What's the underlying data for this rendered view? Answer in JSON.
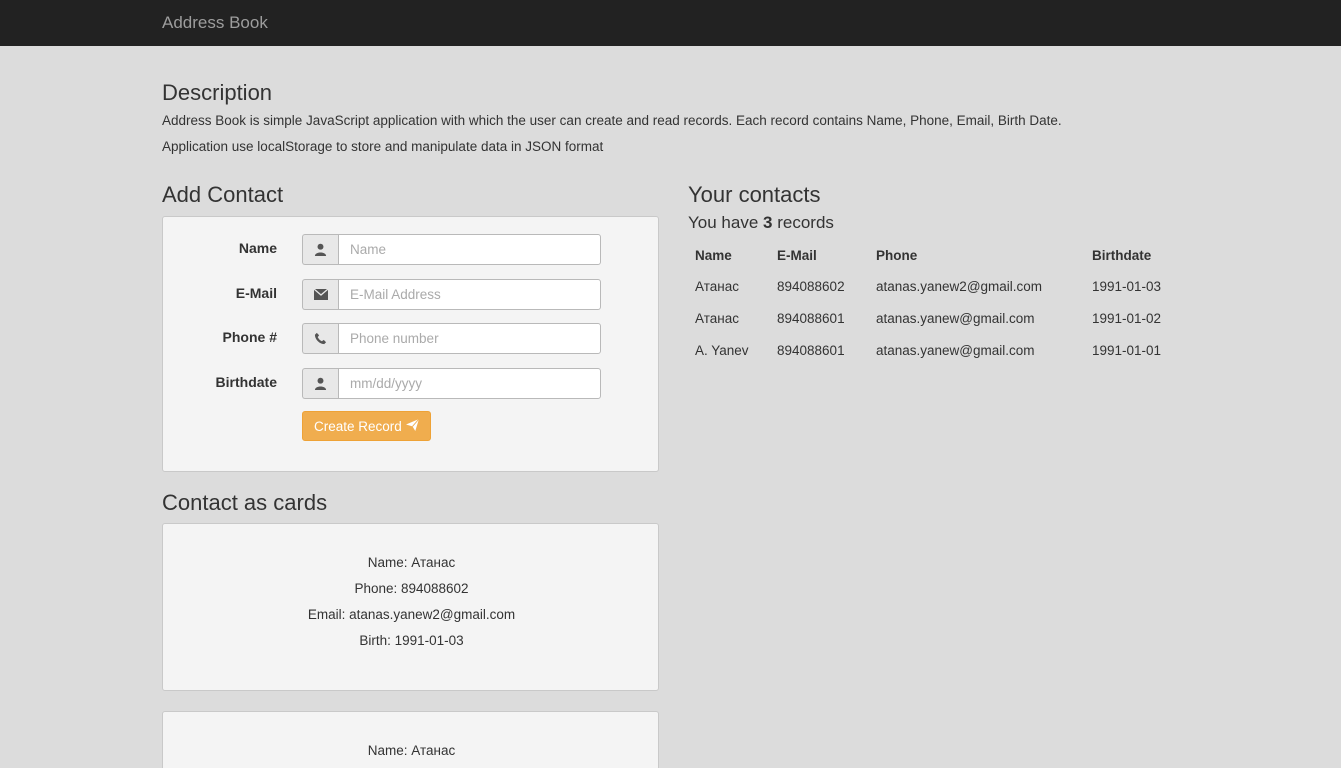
{
  "navbar": {
    "brand": "Address Book"
  },
  "description": {
    "title": "Description",
    "line1": "Address Book is simple JavaScript application with which the user can create and read records. Each record contains Name, Phone, Email, Birth Date.",
    "line2": "Application use localStorage to store and manipulate data in JSON format"
  },
  "add_contact": {
    "title": "Add Contact",
    "fields": [
      {
        "label": "Name",
        "placeholder": "Name",
        "value": "",
        "icon": "user-icon"
      },
      {
        "label": "E-Mail",
        "placeholder": "E-Mail Address",
        "value": "",
        "icon": "envelope-icon"
      },
      {
        "label": "Phone #",
        "placeholder": "Phone number",
        "value": "",
        "icon": "phone-icon"
      },
      {
        "label": "Birthdate",
        "placeholder": "mm/dd/yyyy",
        "value": "",
        "icon": "user-icon"
      }
    ],
    "button_label": "Create Record",
    "button_icon": "send-icon"
  },
  "contacts": {
    "title": "Your contacts",
    "records_prefix": "You have",
    "records_count": "3",
    "records_suffix": "records",
    "headers": [
      "Name",
      "E-Mail",
      "Phone",
      "Birthdate"
    ],
    "rows": [
      [
        "Атанас",
        "894088602",
        "atanas.yanew2@gmail.com",
        "1991-01-03"
      ],
      [
        "Атанас",
        "894088601",
        "atanas.yanew@gmail.com",
        "1991-01-02"
      ],
      [
        "A. Yanev",
        "894088601",
        "atanas.yanew@gmail.com",
        "1991-01-01"
      ]
    ]
  },
  "cards": {
    "title": "Contact as cards",
    "items": [
      {
        "name": "Name: Атанас",
        "phone": "Phone: 894088602",
        "email": "Email: atanas.yanew2@gmail.com",
        "birth": "Birth: 1991-01-03"
      },
      {
        "name": "Name: Атанас"
      }
    ]
  },
  "colors": {
    "navbar": "#222222",
    "background": "#dcdcdc",
    "button": "#f0ad4e"
  }
}
